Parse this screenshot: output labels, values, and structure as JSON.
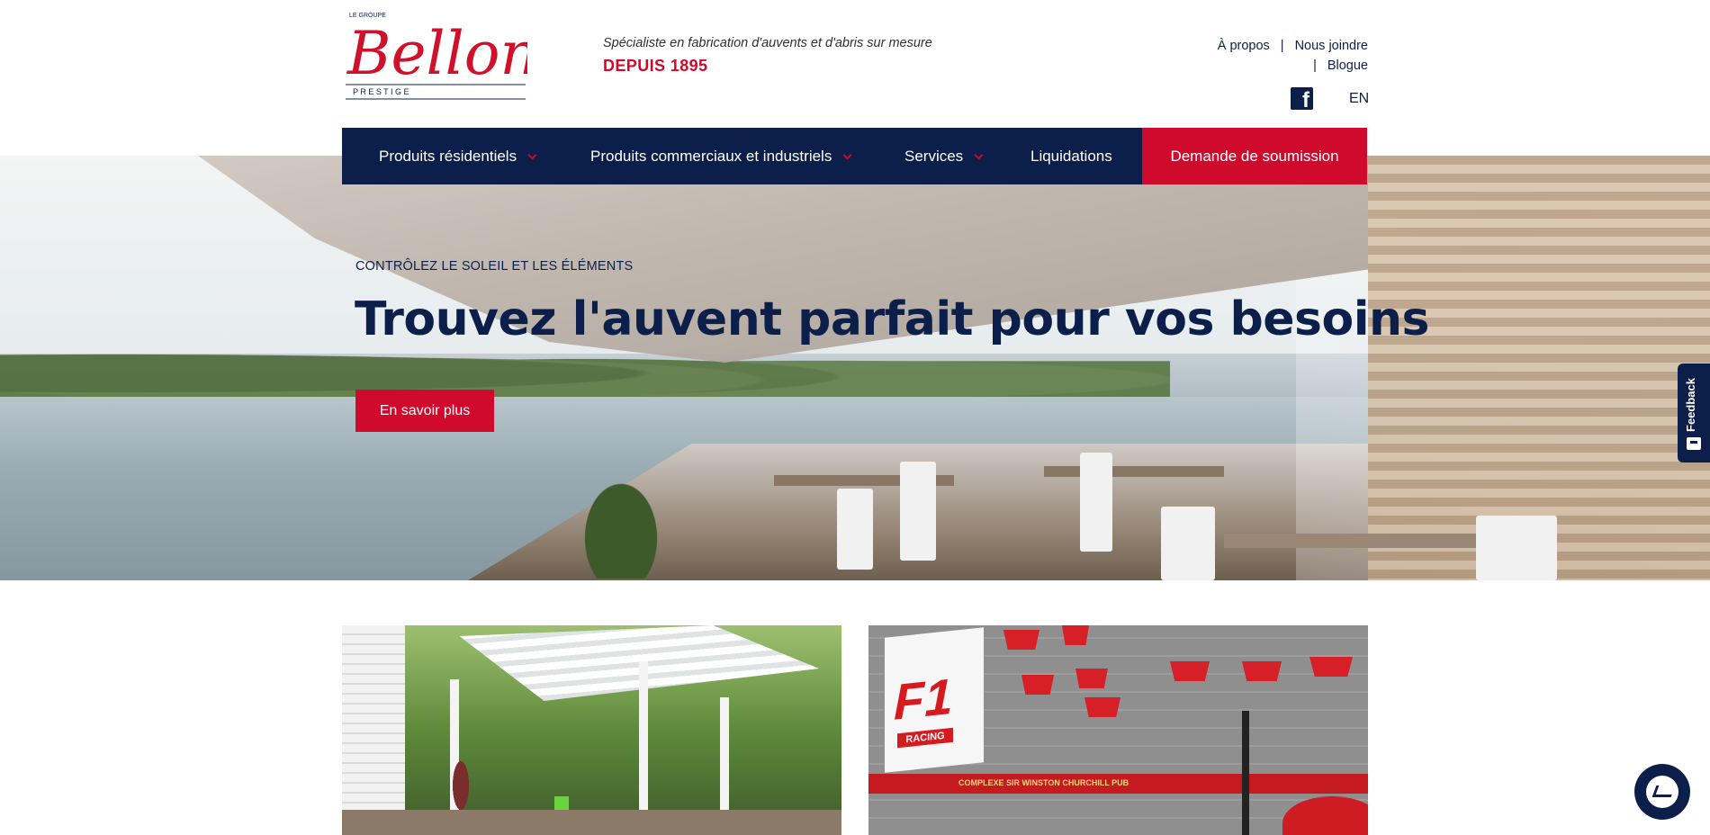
{
  "header": {
    "logo": {
      "small_text": "LE GROUPE",
      "brand": "Bellon",
      "sub": "P R E S T I G E"
    },
    "tagline": "Spécialiste en fabrication d'auvents et d'abris sur mesure",
    "since": "DEPUIS 1895",
    "links": {
      "about": "À propos",
      "contact": "Nous joindre",
      "blog": "Blogue",
      "separator": "|"
    },
    "social_icon": "facebook-icon",
    "facebook_glyph": "f",
    "lang": "EN"
  },
  "nav": {
    "items": [
      {
        "label": "Produits résidentiels"
      },
      {
        "label": "Produits commerciaux et industriels"
      },
      {
        "label": "Services"
      },
      {
        "label": "Liquidations"
      }
    ],
    "cta": "Demande de soumission"
  },
  "hero": {
    "eyebrow": "CONTRÔLEZ LE SOLEIL ET LES ÉLÉMENTS",
    "title": "Trouvez l'auvent parfait pour vos besoins",
    "button": "En savoir plus"
  },
  "cards": {
    "right_sign": "F1",
    "right_sign_sub": "RACING",
    "right_pub": "COMPLEXE SIR WINSTON CHURCHILL PUB"
  },
  "widgets": {
    "feedback_label": "Feedback",
    "messenger_icon": "messenger-icon"
  },
  "colors": {
    "navy": "#0b1f4a",
    "red": "#cf0a2c"
  }
}
